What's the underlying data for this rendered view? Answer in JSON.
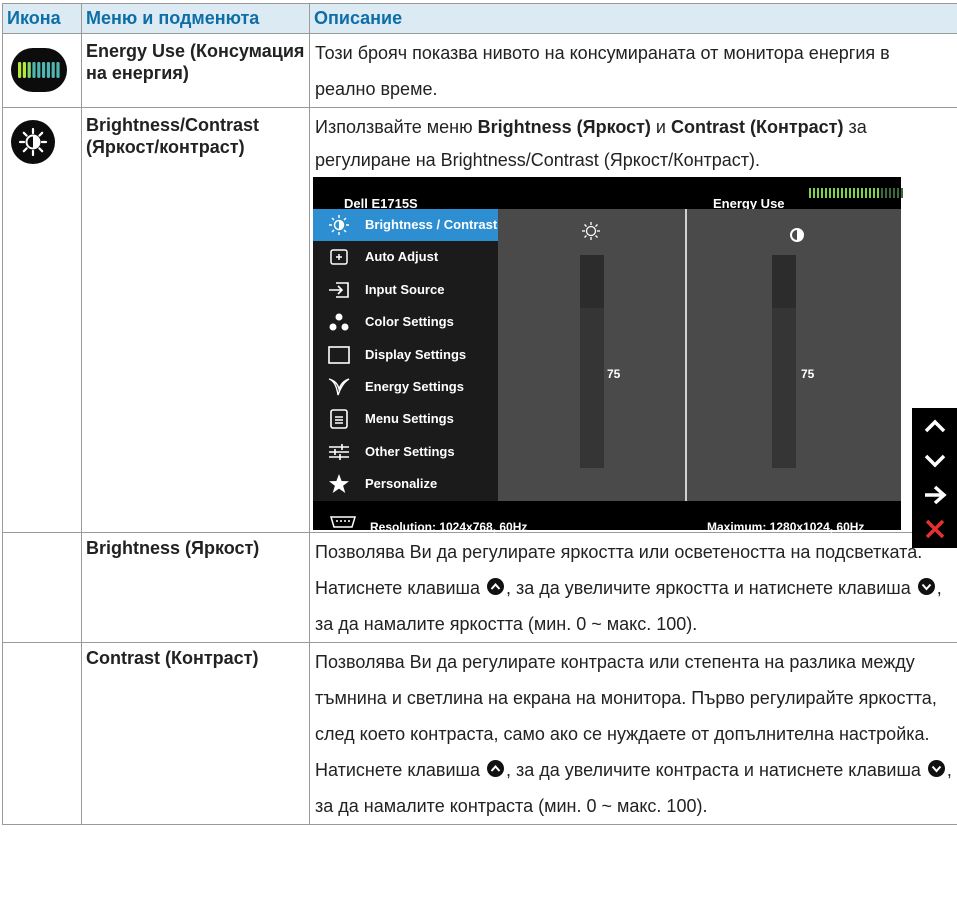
{
  "header": {
    "col_icon": "Икона",
    "col_menu": "Меню и подменюта",
    "col_desc": "Описание"
  },
  "rows": [
    {
      "menu": "Energy Use (Консумация на енергия)",
      "icon": "energy-meter-icon",
      "desc": "Този брояч показва нивото на консумираната от монитора енергия в реално време."
    },
    {
      "menu": "Brightness/Contrast (Яркост/контраст)",
      "icon": "brightness-contrast-icon",
      "desc_pre": "Използвайте меню ",
      "desc_b1": "Brightness (Яркост)",
      "desc_mid": " и ",
      "desc_b2": "Contrast (Контраст)",
      "desc_post": " за регулиране на Brightness/Contrast (Яркост/Контраст)."
    },
    {
      "menu": "Brightness (Яркост)",
      "desc1": "Позволява Ви да регулирате яркостта или осветеността на подсветката.",
      "desc2_a": "Натиснете клавиша ",
      "desc2_b": ", за да увеличите яркостта и натиснете клавиша ",
      "desc2_c": ", за да намалите яркостта (мин. 0 ~ макс. 100)."
    },
    {
      "menu": "Contrast (Контраст)",
      "desc1": "Позволява Ви да регулирате контраста или степента на разлика между тъмнина и светлина на екрана на монитора. Първо регулирайте яркостта, след което контраста, само ако се нуждаете от допълнителна настройка.",
      "desc2_a": "Натиснете клавиша ",
      "desc2_b": ", за да увеличите контраста и натиснете клавиша ",
      "desc2_c": ", за да намалите контраста (мин. 0 ~ макс. 100)."
    }
  ],
  "osd": {
    "model": "Dell E1715S",
    "energy_label": "Energy Use",
    "energy_level": 0.75,
    "menu_items": [
      {
        "label": "Brightness / Contrast",
        "icon": "brightness-icon",
        "active": true
      },
      {
        "label": "Auto Adjust",
        "icon": "auto-adjust-icon"
      },
      {
        "label": "Input Source",
        "icon": "input-source-icon"
      },
      {
        "label": "Color Settings",
        "icon": "color-settings-icon"
      },
      {
        "label": "Display Settings",
        "icon": "display-settings-icon"
      },
      {
        "label": "Energy Settings",
        "icon": "energy-settings-icon"
      },
      {
        "label": "Menu Settings",
        "icon": "menu-settings-icon"
      },
      {
        "label": "Other Settings",
        "icon": "other-settings-icon"
      },
      {
        "label": "Personalize",
        "icon": "star-icon"
      }
    ],
    "brightness_value": "75",
    "contrast_value": "75",
    "brightness_level": 0.75,
    "contrast_level": 0.75,
    "resolution": "Resolution: 1024x768, 60Hz",
    "maximum": "Maximum: 1280x1024, 60Hz"
  },
  "side_keys": [
    "up-arrow-icon",
    "down-arrow-icon",
    "right-arrow-icon",
    "close-x-icon"
  ],
  "colors": {
    "header_bg": "#dcebf3",
    "header_text": "#0d6ea8",
    "osd_active": "#2e8ed2",
    "exit_red": "#e53030"
  }
}
